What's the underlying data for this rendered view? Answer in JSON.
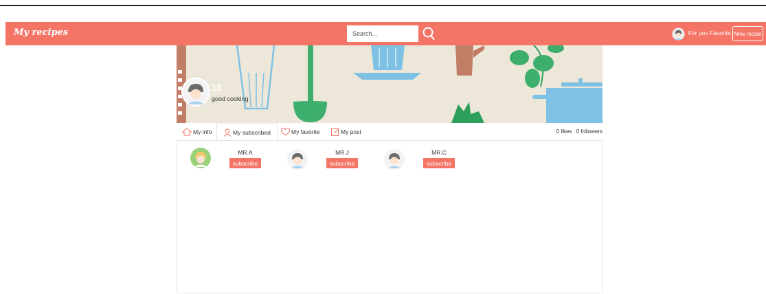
{
  "app": {
    "brand": "My recipes"
  },
  "navbar": {
    "search_placeholder": "Search...",
    "for_you": "For you",
    "favorite": "Favorite",
    "new_recipe": "New recipe"
  },
  "profile": {
    "number": "13",
    "bio": "good cooking"
  },
  "tabs": [
    {
      "label": "My info",
      "icon": "home-icon"
    },
    {
      "label": "My subscribed",
      "icon": "user-icon",
      "active": true
    },
    {
      "label": "My favorite",
      "icon": "heart-icon"
    },
    {
      "label": "My post",
      "icon": "edit-icon"
    }
  ],
  "stats": {
    "likes": "0 likes",
    "followers": "0 followers"
  },
  "subscriptions": [
    {
      "name": "MR.A",
      "button": "subscribe"
    },
    {
      "name": "MR.J",
      "button": "subscribe"
    },
    {
      "name": "MR.C",
      "button": "subscribe"
    }
  ],
  "colors": {
    "accent": "#f47466",
    "banner_bg": "#ede7d9",
    "panel_border": "#e3e3e3"
  }
}
